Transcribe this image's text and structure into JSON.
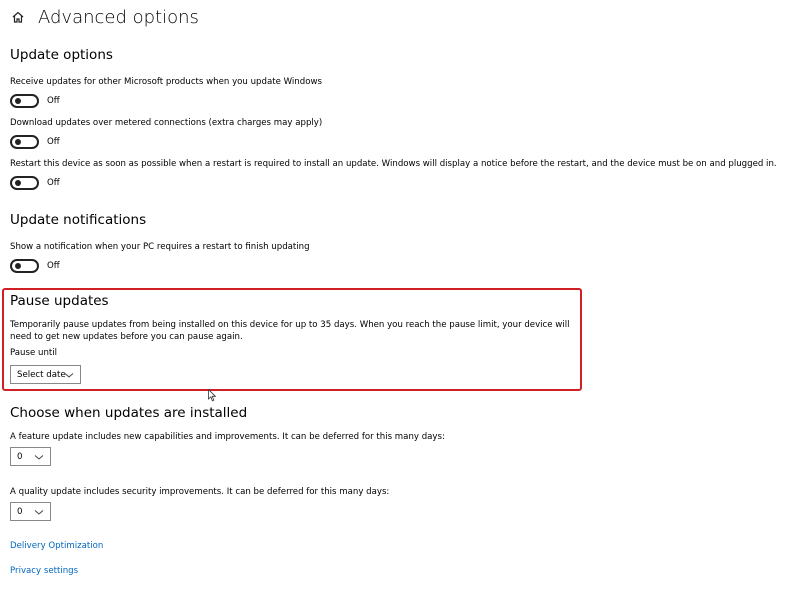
{
  "header": {
    "title": "Advanced options",
    "home_icon": "home-icon"
  },
  "update_options": {
    "title": "Update options",
    "items": [
      {
        "label": "Receive updates for other Microsoft products when you update Windows",
        "state": "Off"
      },
      {
        "label": "Download updates over metered connections (extra charges may apply)",
        "state": "Off"
      },
      {
        "label": "Restart this device as soon as possible when a restart is required to install an update. Windows will display a notice before the restart, and the device must be on and plugged in.",
        "state": "Off"
      }
    ]
  },
  "update_notifications": {
    "title": "Update notifications",
    "label": "Show a notification when your PC requires a restart to finish updating",
    "state": "Off"
  },
  "pause_updates": {
    "title": "Pause updates",
    "description_line1": "Temporarily pause updates from being installed on this device for up to 35 days. When you reach the pause limit, your device will",
    "description_line2": "need to get new updates before you can pause again.",
    "pause_until_label": "Pause until",
    "select_value": "Select date",
    "highlight_color": "#d11f25"
  },
  "choose_updates": {
    "title": "Choose when updates are installed",
    "feature_label": "A feature update includes new capabilities and improvements. It can be deferred for this many days:",
    "feature_value": "0",
    "quality_label": "A quality update includes security improvements. It can be deferred for this many days:",
    "quality_value": "0"
  },
  "links": {
    "delivery_optimization": "Delivery Optimization",
    "privacy_settings": "Privacy settings",
    "link_color": "#0067c0"
  }
}
